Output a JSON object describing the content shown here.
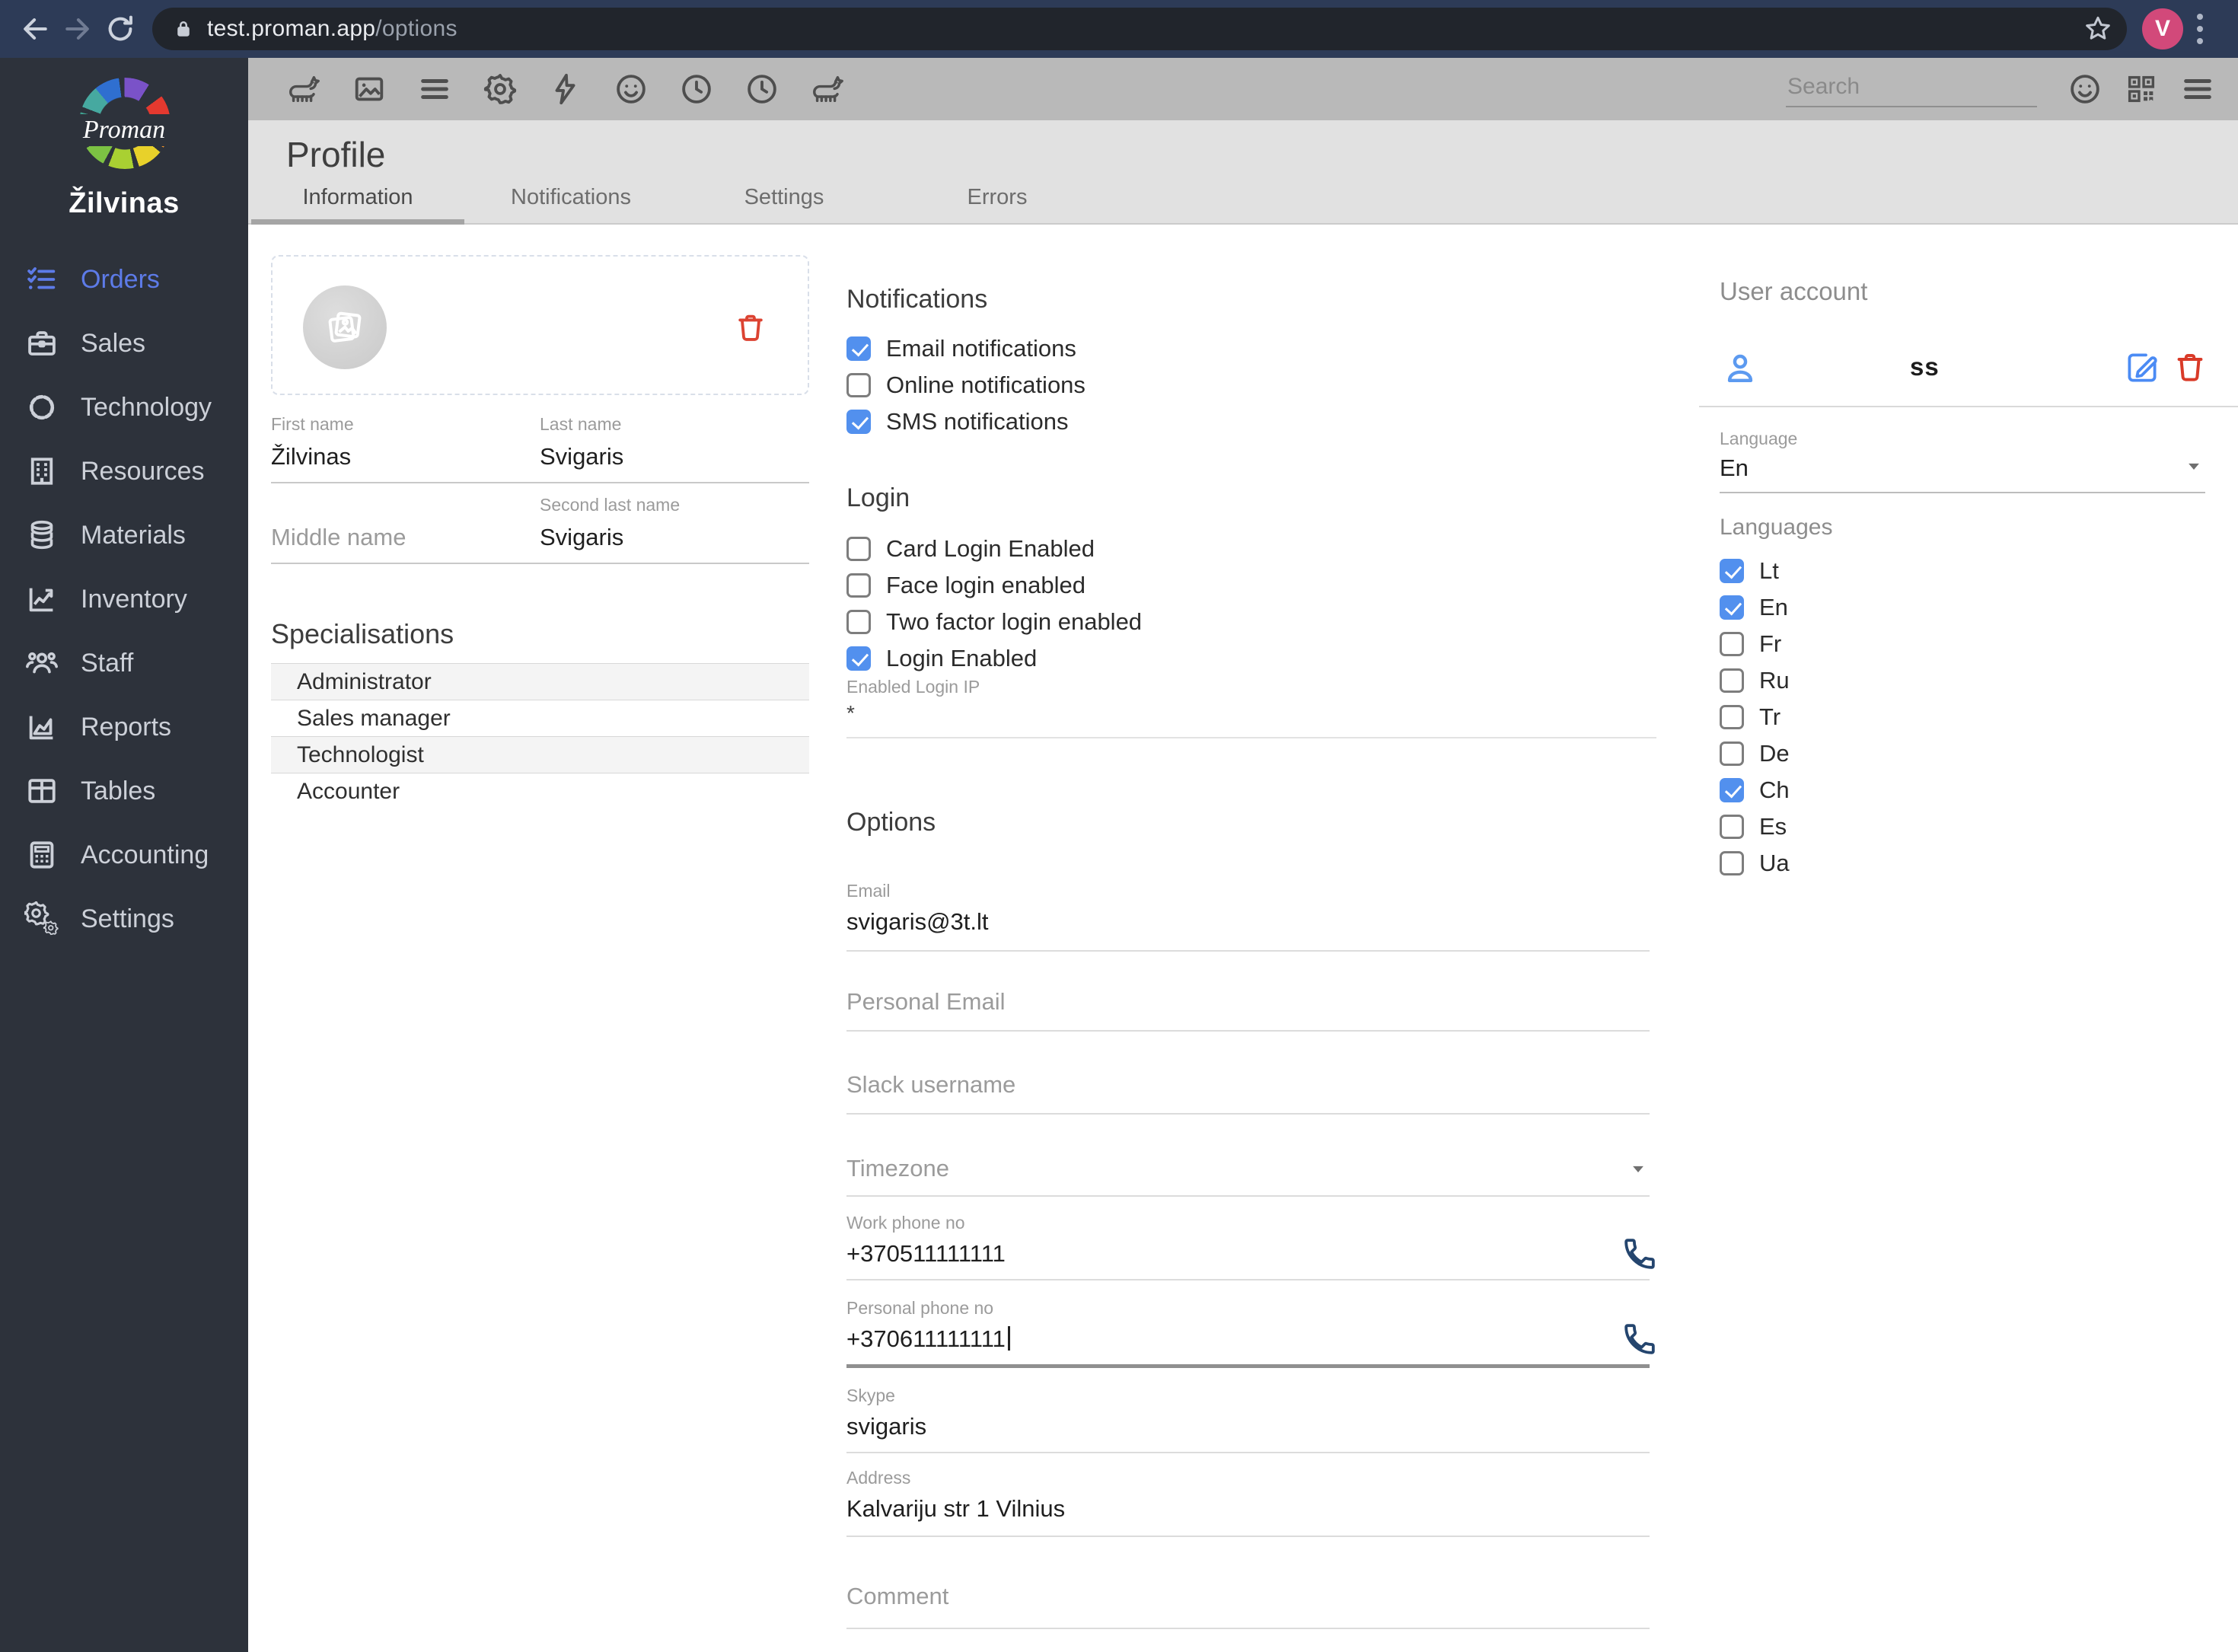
{
  "browser": {
    "url_host": "test.proman.app",
    "url_path": "/options",
    "avatar_initial": "V"
  },
  "sidebar": {
    "logo_text": "Proman",
    "user_name": "Žilvinas",
    "items": [
      {
        "label": "Orders",
        "active": true
      },
      {
        "label": "Sales",
        "active": false
      },
      {
        "label": "Technology",
        "active": false
      },
      {
        "label": "Resources",
        "active": false
      },
      {
        "label": "Materials",
        "active": false
      },
      {
        "label": "Inventory",
        "active": false
      },
      {
        "label": "Staff",
        "active": false
      },
      {
        "label": "Reports",
        "active": false
      },
      {
        "label": "Tables",
        "active": false
      },
      {
        "label": "Accounting",
        "active": false
      },
      {
        "label": "Settings",
        "active": false
      }
    ]
  },
  "toolbar": {
    "search_placeholder": "Search"
  },
  "page": {
    "title": "Profile",
    "tabs": [
      {
        "label": "Information",
        "active": true
      },
      {
        "label": "Notifications",
        "active": false
      },
      {
        "label": "Settings",
        "active": false
      },
      {
        "label": "Errors",
        "active": false
      }
    ]
  },
  "profile": {
    "first_name": {
      "label": "First name",
      "value": "Žilvinas"
    },
    "last_name": {
      "label": "Last name",
      "value": "Svigaris"
    },
    "middle_name": {
      "placeholder": "Middle name",
      "value": ""
    },
    "second_last_name": {
      "label": "Second last name",
      "value": "Svigaris"
    },
    "specialisations": {
      "title": "Specialisations",
      "items": [
        "Administrator",
        "Sales manager",
        "Technologist",
        "Accounter"
      ]
    }
  },
  "notifications": {
    "title": "Notifications",
    "items": [
      {
        "label": "Email notifications",
        "checked": true
      },
      {
        "label": "Online notifications",
        "checked": false
      },
      {
        "label": "SMS notifications",
        "checked": true
      }
    ]
  },
  "login": {
    "title": "Login",
    "items": [
      {
        "label": "Card Login Enabled",
        "checked": false
      },
      {
        "label": "Face login enabled",
        "checked": false
      },
      {
        "label": "Two factor login enabled",
        "checked": false
      },
      {
        "label": "Login Enabled",
        "checked": true
      }
    ],
    "ip_label": "Enabled Login IP",
    "ip_value": "*"
  },
  "options": {
    "title": "Options",
    "email": {
      "label": "Email",
      "value": "svigaris@3t.lt"
    },
    "personal_email": {
      "placeholder": "Personal Email",
      "value": ""
    },
    "slack": {
      "placeholder": "Slack username",
      "value": ""
    },
    "timezone": {
      "placeholder": "Timezone"
    },
    "work_phone": {
      "label": "Work phone no",
      "value": "+370511111111"
    },
    "personal_phone": {
      "label": "Personal phone no",
      "value": "+370611111111"
    },
    "skype": {
      "label": "Skype",
      "value": "svigaris"
    },
    "address": {
      "label": "Address",
      "value": "Kalvariju str 1 Vilnius"
    },
    "comment": {
      "placeholder": "Comment",
      "value": ""
    }
  },
  "user_account": {
    "title": "User account",
    "username": "ss",
    "language": {
      "label": "Language",
      "value": "En"
    },
    "languages": {
      "title": "Languages",
      "items": [
        {
          "label": "Lt",
          "checked": true
        },
        {
          "label": "En",
          "checked": true
        },
        {
          "label": "Fr",
          "checked": false
        },
        {
          "label": "Ru",
          "checked": false
        },
        {
          "label": "Tr",
          "checked": false
        },
        {
          "label": "De",
          "checked": false
        },
        {
          "label": "Ch",
          "checked": true
        },
        {
          "label": "Es",
          "checked": false
        },
        {
          "label": "Ua",
          "checked": false
        }
      ]
    }
  },
  "colors": {
    "accent_blue": "#5290ee",
    "sidebar_active": "#5d7be8",
    "danger_red": "#dc4332",
    "chrome_navy": "#2d3b57",
    "avatar_pink": "#d2497a"
  }
}
